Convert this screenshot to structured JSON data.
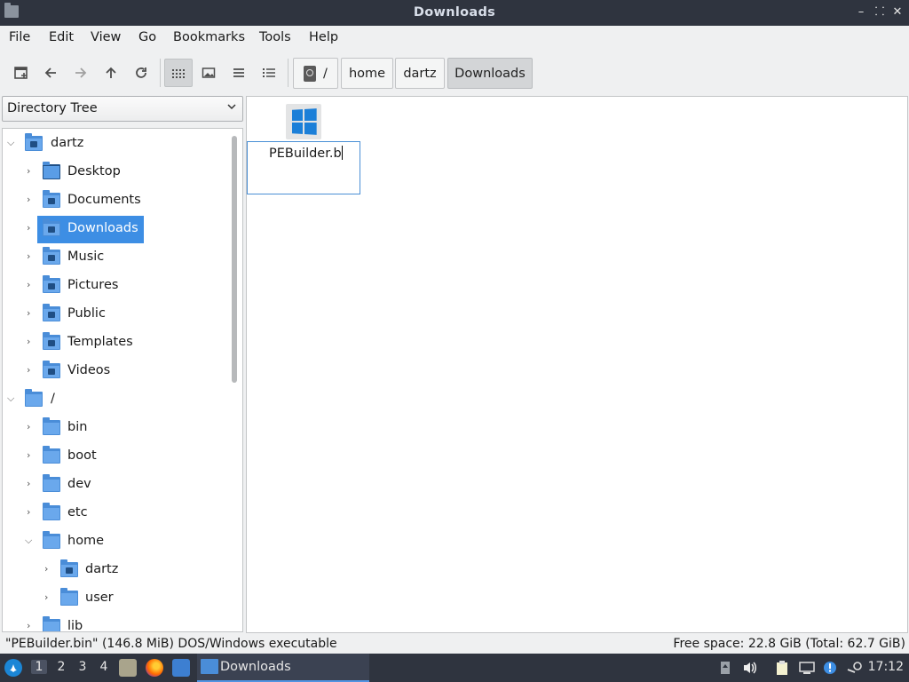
{
  "window": {
    "title": "Downloads",
    "controls": {
      "minimize": "–",
      "restore": "⸬",
      "close": "✕"
    }
  },
  "menu": [
    "File",
    "Edit",
    "View",
    "Go",
    "Bookmarks",
    "Tools",
    "Help"
  ],
  "toolbar": {
    "icons": [
      "new-tab-icon",
      "back-arrow-icon",
      "forward-arrow-icon",
      "up-arrow-icon",
      "reload-icon",
      "icon-view-icon",
      "thumbnail-view-icon",
      "compact-view-icon",
      "detailed-list-view-icon"
    ],
    "active_view": "icon-view"
  },
  "breadcrumb": {
    "root_label": "/",
    "items": [
      "home",
      "dartz",
      "Downloads"
    ],
    "active": "Downloads"
  },
  "side_pane": {
    "mode": "Directory Tree",
    "tree": [
      {
        "label": "dartz",
        "expanded": true,
        "icon": "home-folder-icon"
      },
      {
        "label": "Desktop",
        "icon": "desktop-folder-icon"
      },
      {
        "label": "Documents",
        "icon": "documents-folder-icon"
      },
      {
        "label": "Downloads",
        "icon": "downloads-folder-icon",
        "selected": true
      },
      {
        "label": "Music",
        "icon": "music-folder-icon"
      },
      {
        "label": "Pictures",
        "icon": "pictures-folder-icon"
      },
      {
        "label": "Public",
        "icon": "public-folder-icon"
      },
      {
        "label": "Templates",
        "icon": "templates-folder-icon"
      },
      {
        "label": "Videos",
        "icon": "videos-folder-icon"
      },
      {
        "label": "/",
        "expanded": true,
        "icon": "folder-icon"
      },
      {
        "label": "bin",
        "icon": "folder-icon"
      },
      {
        "label": "boot",
        "icon": "folder-icon"
      },
      {
        "label": "dev",
        "icon": "folder-icon"
      },
      {
        "label": "etc",
        "icon": "folder-icon"
      },
      {
        "label": "home",
        "expanded": true,
        "icon": "folder-icon"
      },
      {
        "label": "dartz",
        "icon": "home-folder-icon"
      },
      {
        "label": "user",
        "icon": "folder-icon"
      },
      {
        "label": "lib",
        "icon": "folder-icon"
      }
    ]
  },
  "files": [
    {
      "rename_value": "PEBuilder.b",
      "icon": "windows-executable-icon"
    }
  ],
  "status": {
    "selection": "\"PEBuilder.bin\" (146.8 MiB) DOS/Windows executable",
    "free_space": "Free space: 22.8 GiB (Total: 62.7 GiB)"
  },
  "taskbar": {
    "workspaces": [
      "1",
      "2",
      "3",
      "4"
    ],
    "active_workspace": "1",
    "task_label": "Downloads",
    "clock": "17:12"
  },
  "colors": {
    "selection": "#3d8ee4",
    "folder": "#4a8dd8",
    "titlebar": "#2f343f"
  }
}
